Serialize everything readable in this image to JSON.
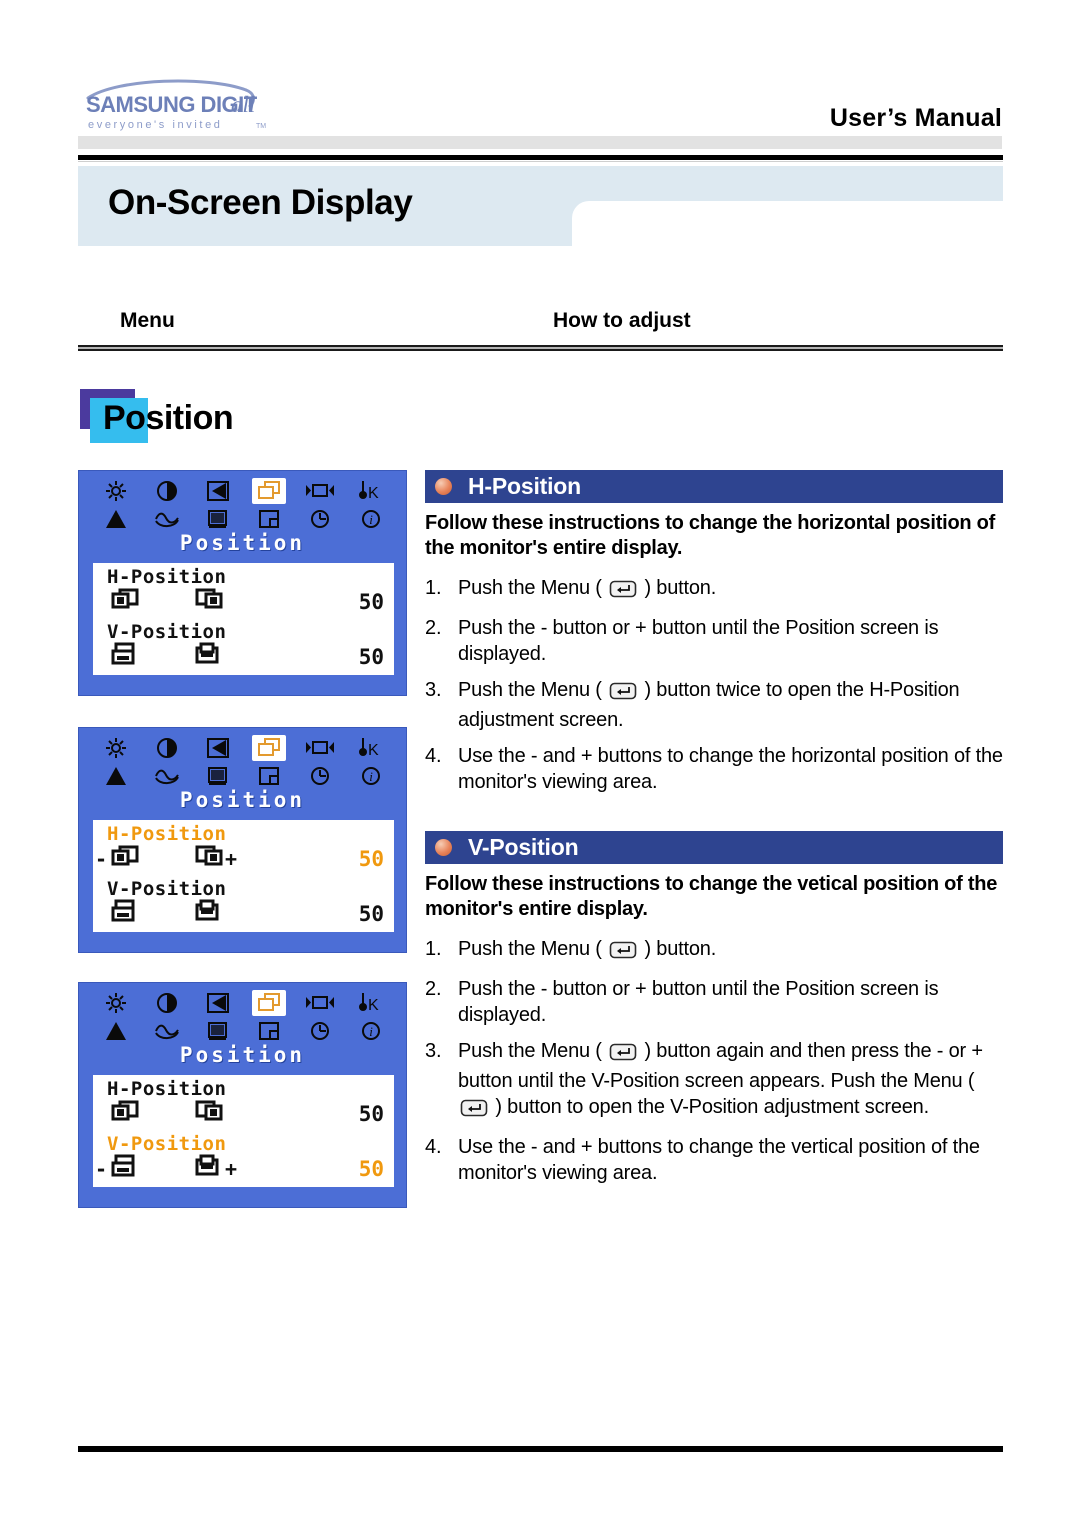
{
  "header": {
    "logo_primary": "SAMSUNG DIGITall",
    "logo_tagline": "everyone's invited",
    "logo_tm": "TM",
    "manual_label": "User’s Manual",
    "logo_color": "#7b8cc2"
  },
  "page": {
    "title": "On-Screen Display",
    "banner_color": "#dde9f1"
  },
  "columns": {
    "menu": "Menu",
    "how_to_adjust": "How to adjust"
  },
  "section_tag": {
    "label": "Position",
    "back_color": "#4b3a9e",
    "front_color": "#35bdee"
  },
  "osd": {
    "background_color": "#4c6ed6",
    "highlight_color": "#f0990f",
    "heading": "Position",
    "icons_row1": [
      "brightness-icon",
      "contrast-icon",
      "trapezoid-icon",
      "position-icon",
      "size-icon",
      "color-temperature-icon"
    ],
    "icons_row2": [
      "pincushion-icon",
      "parallelogram-icon",
      "moire-icon",
      "corner-icon",
      "degauss-icon",
      "information-icon"
    ],
    "selected_icon": "position-icon",
    "screens": [
      {
        "name": "position-menu",
        "rows": [
          {
            "label": "H-Position",
            "value": "50",
            "highlight": false,
            "minus": "",
            "plus": ""
          },
          {
            "label": "V-Position",
            "value": "50",
            "highlight": false,
            "minus": "",
            "plus": ""
          }
        ]
      },
      {
        "name": "h-position-adjust",
        "rows": [
          {
            "label": "H-Position",
            "value": "50",
            "highlight": true,
            "minus": "-",
            "plus": "+"
          },
          {
            "label": "V-Position",
            "value": "50",
            "highlight": false,
            "minus": "",
            "plus": ""
          }
        ]
      },
      {
        "name": "v-position-adjust",
        "rows": [
          {
            "label": "H-Position",
            "value": "50",
            "highlight": false,
            "minus": "",
            "plus": ""
          },
          {
            "label": "V-Position",
            "value": "50",
            "highlight": true,
            "minus": "-",
            "plus": "+"
          }
        ]
      }
    ]
  },
  "sections": [
    {
      "title": "H-Position",
      "description": "Follow these instructions to change the horizontal position of the monitor's entire display.",
      "steps": [
        {
          "pre": "Push the Menu ( ",
          "post": " ) button.",
          "icon": true
        },
        {
          "pre": "Push the - button or + button until the Position screen is displayed.",
          "post": "",
          "icon": false
        },
        {
          "pre": "Push the Menu ( ",
          "post": " ) button twice to open the H-Position adjustment screen.",
          "icon": true
        },
        {
          "pre": "Use the - and + buttons to change the horizontal position of the monitor's viewing area.",
          "post": "",
          "icon": false
        }
      ]
    },
    {
      "title": "V-Position",
      "description": "Follow these instructions to change the vetical position of the monitor's entire display.",
      "steps": [
        {
          "pre": "Push the Menu ( ",
          "post": " ) button.",
          "icon": true
        },
        {
          "pre": "Push the - button or + button until the Position screen is displayed.",
          "post": "",
          "icon": false
        },
        {
          "pre": "Push the Menu ( ",
          "mid": " ) button again and then press the - or + button until the V-Position screen appears. Push the Menu ( ",
          "post": " ) button to open the V-Position adjustment screen.",
          "icon": true,
          "double_icon": true
        },
        {
          "pre": "Use the - and + buttons to change the vertical position of the monitor's viewing area.",
          "post": "",
          "icon": false
        }
      ]
    }
  ],
  "colors": {
    "section_header": "#2e4490",
    "bullet": "#e8835a",
    "rule": "#000000"
  }
}
